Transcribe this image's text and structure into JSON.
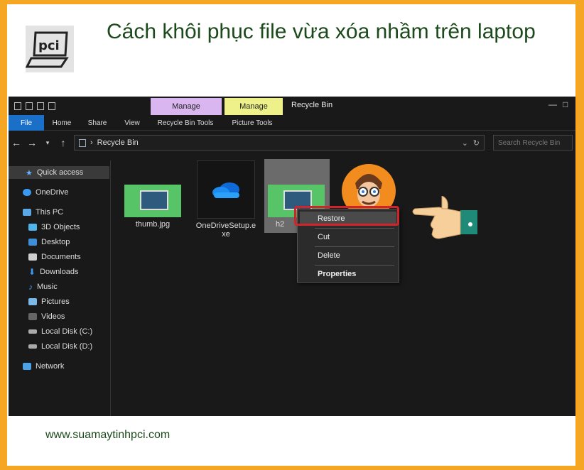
{
  "article": {
    "title": "Cách khôi phục file vừa xóa nhầm trên laptop",
    "website": "www.suamaytinhpci.com",
    "logo_text": "pci"
  },
  "explorer": {
    "window_title": "Recycle Bin",
    "contextual_tabs": [
      {
        "group": "Manage",
        "tab": "Recycle Bin Tools",
        "color": "#d9b6f0"
      },
      {
        "group": "Manage",
        "tab": "Picture Tools",
        "color": "#eef08a"
      }
    ],
    "ribbon_tabs": [
      "File",
      "Home",
      "Share",
      "View"
    ],
    "address": {
      "separator": "›",
      "path": "Recycle Bin"
    },
    "search": {
      "placeholder": "Search Recycle Bin"
    },
    "sidebar": [
      {
        "label": "Quick access",
        "icon": "star-icon"
      },
      {
        "label": "OneDrive",
        "icon": "cloud-icon"
      },
      {
        "label": "This PC",
        "icon": "monitor-icon"
      },
      {
        "label": "3D Objects",
        "icon": "cube-icon"
      },
      {
        "label": "Desktop",
        "icon": "desktop-icon"
      },
      {
        "label": "Documents",
        "icon": "document-icon"
      },
      {
        "label": "Downloads",
        "icon": "download-icon"
      },
      {
        "label": "Music",
        "icon": "music-icon"
      },
      {
        "label": "Pictures",
        "icon": "picture-icon"
      },
      {
        "label": "Videos",
        "icon": "video-icon"
      },
      {
        "label": "Local Disk (C:)",
        "icon": "drive-icon"
      },
      {
        "label": "Local Disk (D:)",
        "icon": "drive-icon"
      },
      {
        "label": "Network",
        "icon": "network-icon"
      }
    ],
    "files": [
      {
        "name": "thumb.jpg"
      },
      {
        "name_line1": "OneDriveSetup.e",
        "name_line2": "xe"
      },
      {
        "name": "h2"
      }
    ],
    "context_menu": {
      "items": [
        "Restore",
        "Cut",
        "Delete",
        "Properties"
      ],
      "highlight_color": "#d0232a"
    }
  },
  "colors": {
    "border": "#f5a623",
    "title": "#1c4a1c",
    "accent": "#1a6fc9"
  }
}
